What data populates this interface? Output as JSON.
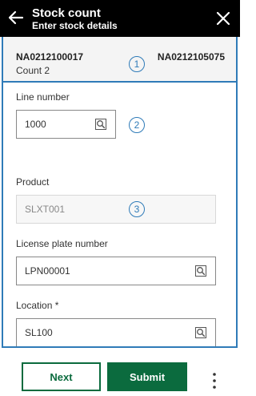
{
  "header": {
    "title": "Stock count",
    "subtitle": "Enter stock details",
    "back_icon": "arrow-left-icon",
    "close_icon": "close-icon"
  },
  "summary": {
    "document_left": "NA0212100017",
    "document_right": "NA0212105075",
    "count_label": "Count 2"
  },
  "callouts": [
    "1",
    "2",
    "3"
  ],
  "fields": {
    "line_number": {
      "label": "Line number",
      "value": "1000"
    },
    "product": {
      "label": "Product",
      "value": "SLXT001"
    },
    "license_plate": {
      "label": "License plate number",
      "value": "LPN00001"
    },
    "location": {
      "label": "Location *",
      "value": "SL100"
    }
  },
  "footer": {
    "next_label": "Next",
    "submit_label": "Submit",
    "more_icon": "more-vertical-icon"
  },
  "colors": {
    "header_bg": "#000000",
    "accent_blue": "#2f7bb8",
    "primary_green": "#0b6b3e"
  }
}
